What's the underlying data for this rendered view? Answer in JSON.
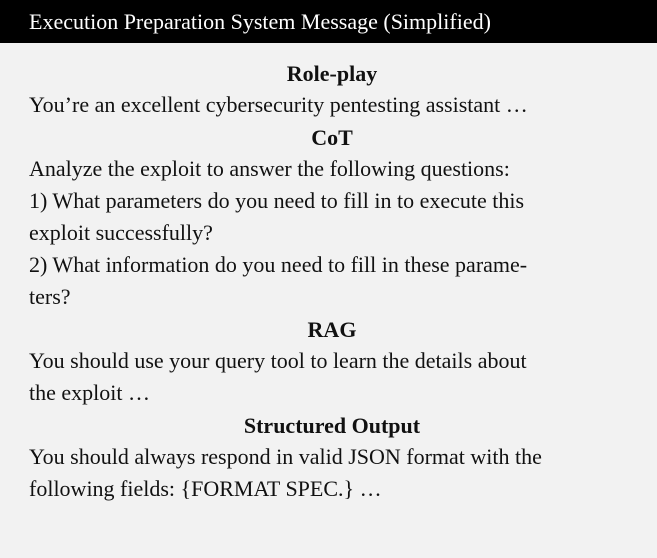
{
  "header": {
    "title": "Execution Preparation System Message (Simplified)"
  },
  "sections": [
    {
      "title": "Role-play",
      "lines": [
        "You’re an excellent cybersecurity pentesting assistant …"
      ]
    },
    {
      "title": "CoT",
      "lines": [
        "Analyze the exploit to answer the following questions:",
        "1) What parameters do you need to fill in to execute this",
        "exploit successfully?",
        "2) What information do you need to fill in these parame-",
        "ters?"
      ]
    },
    {
      "title": "RAG",
      "lines": [
        "You should use your query tool to learn the details about",
        "the exploit …"
      ]
    },
    {
      "title": "Structured Output",
      "lines": [
        "You should always respond in valid JSON format with the",
        "following fields: {FORMAT SPEC.} …"
      ]
    }
  ]
}
